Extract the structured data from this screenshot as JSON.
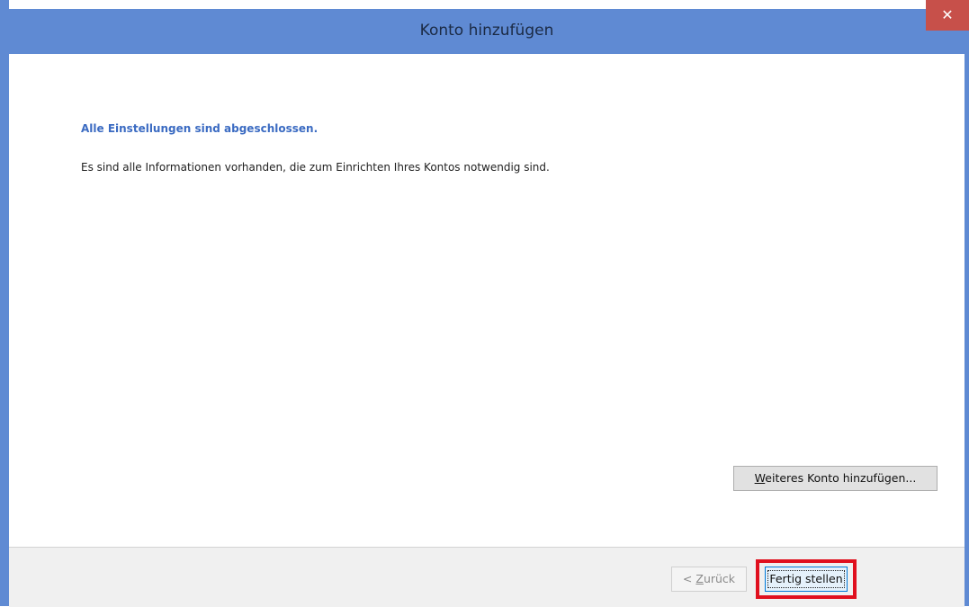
{
  "window": {
    "title": "Konto hinzufügen",
    "close_symbol": "✕"
  },
  "content": {
    "heading": "Alle Einstellungen sind abgeschlossen.",
    "info": "Es sind alle Informationen vorhanden, die zum Einrichten Ihres Kontos notwendig sind.",
    "add_account_button": {
      "mnemonic": "W",
      "rest": "eiteres Konto hinzufügen..."
    }
  },
  "footer": {
    "back_button": {
      "prefix": "< ",
      "mnemonic": "Z",
      "rest": "urück"
    },
    "finish_button": "Fertig stellen"
  },
  "colors": {
    "titlebar": "#5f8ad3",
    "heading": "#3b6bc2",
    "close": "#c7504a",
    "highlight": "#e0101e"
  },
  "icons": [
    "close-icon"
  ]
}
